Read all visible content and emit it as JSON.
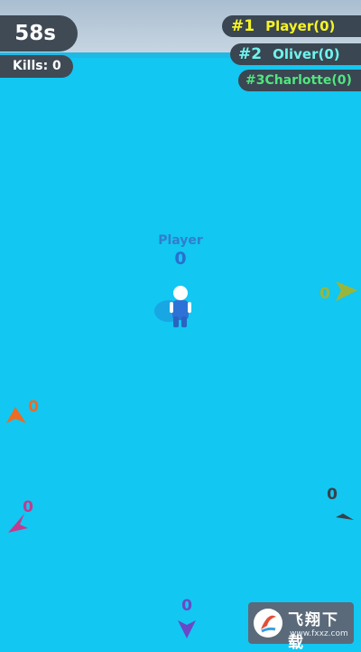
{
  "hud": {
    "timer": "58s",
    "kills": "Kills: 0"
  },
  "leaderboard": [
    {
      "rank": "#1",
      "name": "Player(0)",
      "color": "#f5f325"
    },
    {
      "rank": "#2",
      "name": "Oliver(0)",
      "color": "#6ff3ee"
    },
    {
      "rank": "#3",
      "name": "Charlotte(0)",
      "color": "#52e57f"
    }
  ],
  "player": {
    "name": "Player",
    "score": "0",
    "color": "#2a6fcf"
  },
  "enemies": [
    {
      "score": "0",
      "color": "#9ab63a",
      "icon": "arrow-right-icon"
    },
    {
      "score": "0",
      "color": "#ee6b22",
      "icon": "arrow-left-icon"
    },
    {
      "score": "0",
      "color": "#c13c8f",
      "icon": "arrow-left-icon"
    },
    {
      "score": "0",
      "color": "#394049",
      "icon": "arrow-right-icon"
    },
    {
      "score": "0",
      "color": "#6a48c8",
      "icon": "arrow-down-icon"
    }
  ],
  "watermark": {
    "text_cn": "飞翔下载",
    "url": "www.fxxz.com"
  },
  "colors": {
    "arena": "#12c7f1",
    "hud_bg": "#3f4a55"
  }
}
